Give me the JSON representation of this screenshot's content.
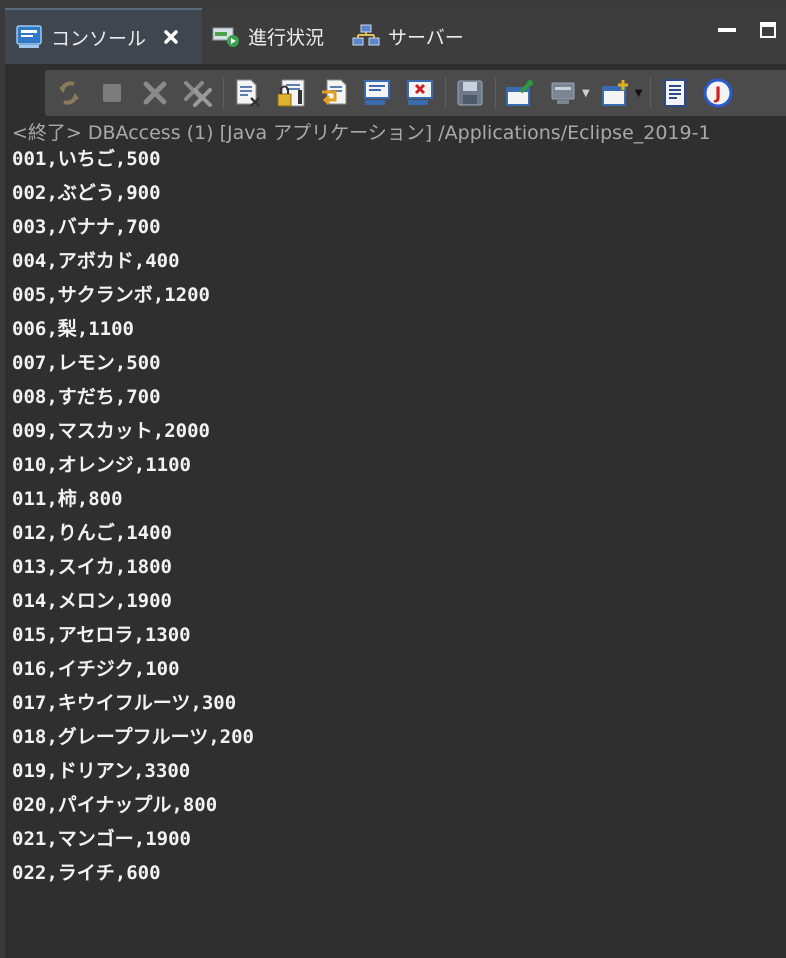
{
  "tabs": [
    {
      "label": "コンソール",
      "icon": "console-icon",
      "active": true,
      "closable": true
    },
    {
      "label": "進行状況",
      "icon": "progress-icon",
      "active": false
    },
    {
      "label": "サーバー",
      "icon": "servers-icon",
      "active": false
    }
  ],
  "toolbar": {
    "buttons": [
      {
        "name": "sync-icon"
      },
      {
        "name": "terminate-icon"
      },
      {
        "name": "remove-launch-icon"
      },
      {
        "name": "remove-all-terminated-icon"
      },
      {
        "name": "clear-console-icon"
      },
      {
        "name": "scroll-lock-icon"
      },
      {
        "name": "word-wrap-icon"
      },
      {
        "name": "show-on-stdout-icon"
      },
      {
        "name": "show-on-stderr-icon"
      },
      {
        "name": "save-icon"
      },
      {
        "name": "pin-console-icon"
      },
      {
        "name": "display-console-icon"
      },
      {
        "name": "open-console-icon"
      },
      {
        "name": "properties-icon"
      },
      {
        "name": "java-stack-trace-icon"
      }
    ]
  },
  "console": {
    "header": "<終了> DBAccess (1) [Java アプリケーション] /Applications/Eclipse_2019-1",
    "lines": [
      "001,いちご,500",
      "002,ぶどう,900",
      "003,バナナ,700",
      "004,アボカド,400",
      "005,サクランボ,1200",
      "006,梨,1100",
      "007,レモン,500",
      "008,すだち,700",
      "009,マスカット,2000",
      "010,オレンジ,1100",
      "011,柿,800",
      "012,りんご,1400",
      "013,スイカ,1800",
      "014,メロン,1900",
      "015,アセロラ,1300",
      "016,イチジク,100",
      "017,キウイフルーツ,300",
      "018,グレープフルーツ,200",
      "019,ドリアン,3300",
      "020,パイナップル,800",
      "021,マンゴー,1900",
      "022,ライチ,600"
    ]
  },
  "colors": {
    "background": "#2f2f2f",
    "text": "#f2f2f2",
    "header_text": "#a9a9a9",
    "toolbar": "#4b4b4b",
    "active_tab": "#3f4650"
  }
}
